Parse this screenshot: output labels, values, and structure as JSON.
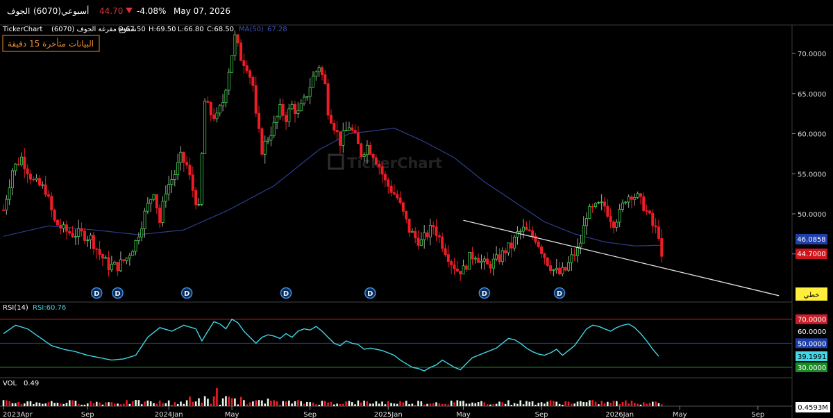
{
  "header": {
    "stock_name": "الجوف",
    "stock_code": "(6070)",
    "period": "أسبوعي",
    "price": "44.70",
    "change_pct": "-4.08%",
    "date": "May 07, 2026",
    "down_icon": "triangle-down-icon"
  },
  "legend": {
    "brand": "TickerChart",
    "series_label": "شموع مفرغة الجوف (6070)",
    "open": "O:67.50",
    "high": "H:69.50",
    "low": "L:66.80",
    "close": "C:68.50",
    "ma_label": "MA(50)",
    "ma_value": "67.28",
    "delay_notice": "البيانات متأخرة 15 دقيقة",
    "watermark": "TickerChart"
  },
  "price_axis": {
    "ticks": [
      "70.0000",
      "65.0000",
      "60.0000",
      "55.0000",
      "50.0000",
      "45.0000"
    ],
    "ma_badge": "46.0858",
    "price_badge": "44.7000",
    "scale_badge": "خطي"
  },
  "rsi_panel": {
    "label": "RSI(14)",
    "value_label": "RSI:60.76",
    "ticks": [
      "70.0000",
      "60.0000",
      "50.0000",
      "39.1991",
      "30.0000"
    ]
  },
  "vol_panel": {
    "label": "VOL",
    "value_label": "0.49",
    "badge": "0.4593M"
  },
  "x_axis": {
    "ticks": [
      "2023Apr",
      "Sep",
      "2024Jan",
      "May",
      "Sep",
      "2025Jan",
      "May",
      "Sep",
      "2026Jan",
      "May",
      "Sep"
    ]
  },
  "dividend_marker": "D",
  "colors": {
    "up": "#3fd44d",
    "down": "#ee1c25",
    "ma": "#2b3f8c",
    "rsi": "#3fd8e8",
    "rsi70": "#c8202a",
    "rsi30": "#1d8a2a",
    "trendline": "#e0e0e0",
    "ma_badge": "#1f3fa8",
    "price_badge": "#d0141c",
    "scale_badge": "#ffef3a",
    "orange": "#e98d2e"
  },
  "chart_data": {
    "type": "candlestick",
    "title": "",
    "x_start": "2023-04",
    "x_end": "2026-09",
    "ylim": [
      42,
      72.5
    ],
    "series": [
      {
        "name": "price_anchors",
        "points": [
          [
            0,
            50.5
          ],
          [
            3,
            55.5
          ],
          [
            6,
            57
          ],
          [
            10,
            54
          ],
          [
            14,
            53
          ],
          [
            17,
            49
          ],
          [
            20,
            48
          ],
          [
            23,
            47.5
          ],
          [
            26,
            47.5
          ],
          [
            29,
            47
          ],
          [
            32,
            45
          ],
          [
            35,
            43.5
          ],
          [
            38,
            43.5
          ],
          [
            41,
            44.5
          ],
          [
            44,
            46.5
          ],
          [
            47,
            50
          ],
          [
            50,
            53
          ],
          [
            52,
            49
          ],
          [
            54,
            53
          ],
          [
            57,
            55
          ],
          [
            59,
            57
          ],
          [
            61,
            56
          ],
          [
            63,
            53
          ],
          [
            65,
            50.5
          ],
          [
            67,
            64
          ],
          [
            69,
            62.5
          ],
          [
            71,
            62
          ],
          [
            73,
            64
          ],
          [
            75,
            68
          ],
          [
            77,
            72
          ],
          [
            79,
            69.5
          ],
          [
            81,
            68.5
          ],
          [
            83,
            66
          ],
          [
            84,
            62
          ],
          [
            86,
            58
          ],
          [
            88,
            59.5
          ],
          [
            90,
            61
          ],
          [
            92,
            63
          ],
          [
            94,
            62
          ],
          [
            96,
            63.5
          ],
          [
            98,
            62.5
          ],
          [
            100,
            64
          ],
          [
            103,
            67
          ],
          [
            105,
            68.5
          ],
          [
            107,
            66
          ],
          [
            108,
            63
          ],
          [
            110,
            61
          ],
          [
            112,
            59
          ],
          [
            115,
            61
          ],
          [
            117,
            59.5
          ],
          [
            119,
            57.5
          ],
          [
            121,
            58.5
          ],
          [
            123,
            57.5
          ],
          [
            125,
            56
          ],
          [
            127,
            54
          ],
          [
            129,
            53
          ],
          [
            131,
            52
          ],
          [
            133,
            50
          ],
          [
            135,
            48
          ],
          [
            137,
            47
          ],
          [
            139,
            46.5
          ],
          [
            141,
            47.5
          ],
          [
            143,
            48.5
          ],
          [
            145,
            47
          ],
          [
            147,
            45.5
          ],
          [
            149,
            44
          ],
          [
            151,
            43
          ],
          [
            153,
            43
          ],
          [
            155,
            44.5
          ],
          [
            157,
            45
          ],
          [
            159,
            44
          ],
          [
            161,
            43.5
          ],
          [
            163,
            44
          ],
          [
            165,
            44.5
          ],
          [
            167,
            45.5
          ],
          [
            169,
            46
          ],
          [
            171,
            47.5
          ],
          [
            173,
            48
          ],
          [
            175,
            47.5
          ],
          [
            177,
            47
          ],
          [
            179,
            45.5
          ],
          [
            181,
            44
          ],
          [
            183,
            43
          ],
          [
            185,
            42.5
          ],
          [
            187,
            43
          ],
          [
            189,
            44.5
          ],
          [
            191,
            45.5
          ],
          [
            192,
            46.5
          ],
          [
            194,
            50
          ],
          [
            196,
            50.5
          ],
          [
            198,
            51
          ],
          [
            200,
            51
          ],
          [
            202,
            49.5
          ],
          [
            203,
            49
          ],
          [
            205,
            50
          ],
          [
            207,
            52
          ],
          [
            209,
            52.5
          ],
          [
            211,
            52
          ],
          [
            213,
            51
          ],
          [
            215,
            49.5
          ],
          [
            216,
            48.5
          ],
          [
            218,
            47.5
          ],
          [
            219,
            44.7
          ]
        ]
      },
      {
        "name": "MA(50)",
        "points": [
          [
            0,
            47.2
          ],
          [
            15,
            48.5
          ],
          [
            30,
            48
          ],
          [
            45,
            47.4
          ],
          [
            60,
            48
          ],
          [
            75,
            50.5
          ],
          [
            90,
            53.5
          ],
          [
            105,
            58
          ],
          [
            115,
            60
          ],
          [
            122,
            60.3
          ],
          [
            130,
            60.7
          ],
          [
            140,
            59
          ],
          [
            150,
            57
          ],
          [
            160,
            54
          ],
          [
            170,
            51.5
          ],
          [
            180,
            49
          ],
          [
            190,
            47.5
          ],
          [
            200,
            46.5
          ],
          [
            210,
            46
          ],
          [
            219,
            46.0858
          ]
        ]
      },
      {
        "name": "RSI(14)",
        "points": [
          [
            0,
            58
          ],
          [
            4,
            65
          ],
          [
            8,
            62
          ],
          [
            12,
            55
          ],
          [
            16,
            48
          ],
          [
            20,
            45
          ],
          [
            24,
            43
          ],
          [
            28,
            40
          ],
          [
            32,
            38
          ],
          [
            36,
            36
          ],
          [
            40,
            37
          ],
          [
            44,
            40
          ],
          [
            48,
            55
          ],
          [
            52,
            63
          ],
          [
            56,
            60
          ],
          [
            60,
            65
          ],
          [
            64,
            62
          ],
          [
            66,
            52
          ],
          [
            68,
            60
          ],
          [
            70,
            68
          ],
          [
            72,
            66
          ],
          [
            74,
            62
          ],
          [
            76,
            70
          ],
          [
            78,
            67
          ],
          [
            80,
            60
          ],
          [
            82,
            55
          ],
          [
            84,
            50
          ],
          [
            86,
            55
          ],
          [
            88,
            57
          ],
          [
            90,
            56
          ],
          [
            92,
            54
          ],
          [
            94,
            58
          ],
          [
            96,
            55
          ],
          [
            98,
            60
          ],
          [
            100,
            62
          ],
          [
            102,
            61
          ],
          [
            104,
            64
          ],
          [
            106,
            60
          ],
          [
            108,
            55
          ],
          [
            110,
            50
          ],
          [
            112,
            48
          ],
          [
            114,
            52
          ],
          [
            116,
            50
          ],
          [
            118,
            49
          ],
          [
            120,
            45
          ],
          [
            122,
            46
          ],
          [
            124,
            45
          ],
          [
            126,
            44
          ],
          [
            128,
            42
          ],
          [
            130,
            40
          ],
          [
            132,
            36
          ],
          [
            134,
            33
          ],
          [
            136,
            30
          ],
          [
            138,
            29
          ],
          [
            140,
            27
          ],
          [
            142,
            30
          ],
          [
            144,
            32
          ],
          [
            146,
            36
          ],
          [
            148,
            33
          ],
          [
            150,
            30
          ],
          [
            152,
            28
          ],
          [
            154,
            33
          ],
          [
            156,
            38
          ],
          [
            158,
            40
          ],
          [
            160,
            42
          ],
          [
            162,
            44
          ],
          [
            164,
            46
          ],
          [
            166,
            50
          ],
          [
            168,
            54
          ],
          [
            170,
            53
          ],
          [
            172,
            50
          ],
          [
            174,
            46
          ],
          [
            176,
            43
          ],
          [
            178,
            41
          ],
          [
            180,
            40
          ],
          [
            182,
            42
          ],
          [
            184,
            45
          ],
          [
            186,
            40
          ],
          [
            188,
            44
          ],
          [
            190,
            48
          ],
          [
            192,
            55
          ],
          [
            194,
            62
          ],
          [
            196,
            65
          ],
          [
            198,
            64
          ],
          [
            200,
            62
          ],
          [
            202,
            60
          ],
          [
            204,
            63
          ],
          [
            206,
            65
          ],
          [
            208,
            66
          ],
          [
            210,
            63
          ],
          [
            212,
            58
          ],
          [
            214,
            52
          ],
          [
            216,
            45
          ],
          [
            218,
            39.1991
          ]
        ]
      }
    ],
    "rsi_levels": [
      70,
      50,
      30
    ],
    "dividends_at": [
      31,
      38,
      61,
      94,
      122,
      160,
      185
    ],
    "trendline": [
      [
        153,
        49.2
      ],
      [
        258,
        39.8
      ]
    ],
    "volume_spike_at": [
      71
    ],
    "volume_last": 0.4593
  }
}
